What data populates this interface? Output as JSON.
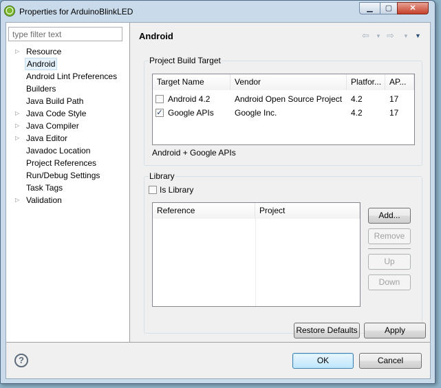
{
  "window": {
    "title": "Properties for ArduinoBlinkLED"
  },
  "filter": {
    "placeholder": "type filter text"
  },
  "tree": [
    {
      "label": "Resource",
      "expandable": true
    },
    {
      "label": "Android",
      "expandable": false,
      "selected": true
    },
    {
      "label": "Android Lint Preferences",
      "expandable": false
    },
    {
      "label": "Builders",
      "expandable": false
    },
    {
      "label": "Java Build Path",
      "expandable": false
    },
    {
      "label": "Java Code Style",
      "expandable": true
    },
    {
      "label": "Java Compiler",
      "expandable": true
    },
    {
      "label": "Java Editor",
      "expandable": true
    },
    {
      "label": "Javadoc Location",
      "expandable": false
    },
    {
      "label": "Project References",
      "expandable": false
    },
    {
      "label": "Run/Debug Settings",
      "expandable": false
    },
    {
      "label": "Task Tags",
      "expandable": false
    },
    {
      "label": "Validation",
      "expandable": true
    }
  ],
  "page": {
    "title": "Android"
  },
  "build_target": {
    "group_label": "Project Build Target",
    "columns": [
      "Target Name",
      "Vendor",
      "Platfor...",
      "AP..."
    ],
    "rows": [
      {
        "checked": false,
        "name": "Android 4.2",
        "vendor": "Android Open Source Project",
        "platform": "4.2",
        "api": "17"
      },
      {
        "checked": true,
        "name": "Google APIs",
        "vendor": "Google Inc.",
        "platform": "4.2",
        "api": "17"
      }
    ],
    "selected_description": "Android + Google APIs"
  },
  "library": {
    "group_label": "Library",
    "is_library_label": "Is Library",
    "is_library_checked": false,
    "columns": [
      "Reference",
      "Project"
    ],
    "buttons": {
      "add": "Add...",
      "remove": "Remove",
      "up": "Up",
      "down": "Down"
    }
  },
  "page_buttons": {
    "restore": "Restore Defaults",
    "apply": "Apply"
  },
  "dialog_buttons": {
    "ok": "OK",
    "cancel": "Cancel"
  },
  "colors": {
    "selection": "#e5f1fb",
    "default_button_border": "#3c7fb1",
    "title_bar": "#c9daea"
  }
}
